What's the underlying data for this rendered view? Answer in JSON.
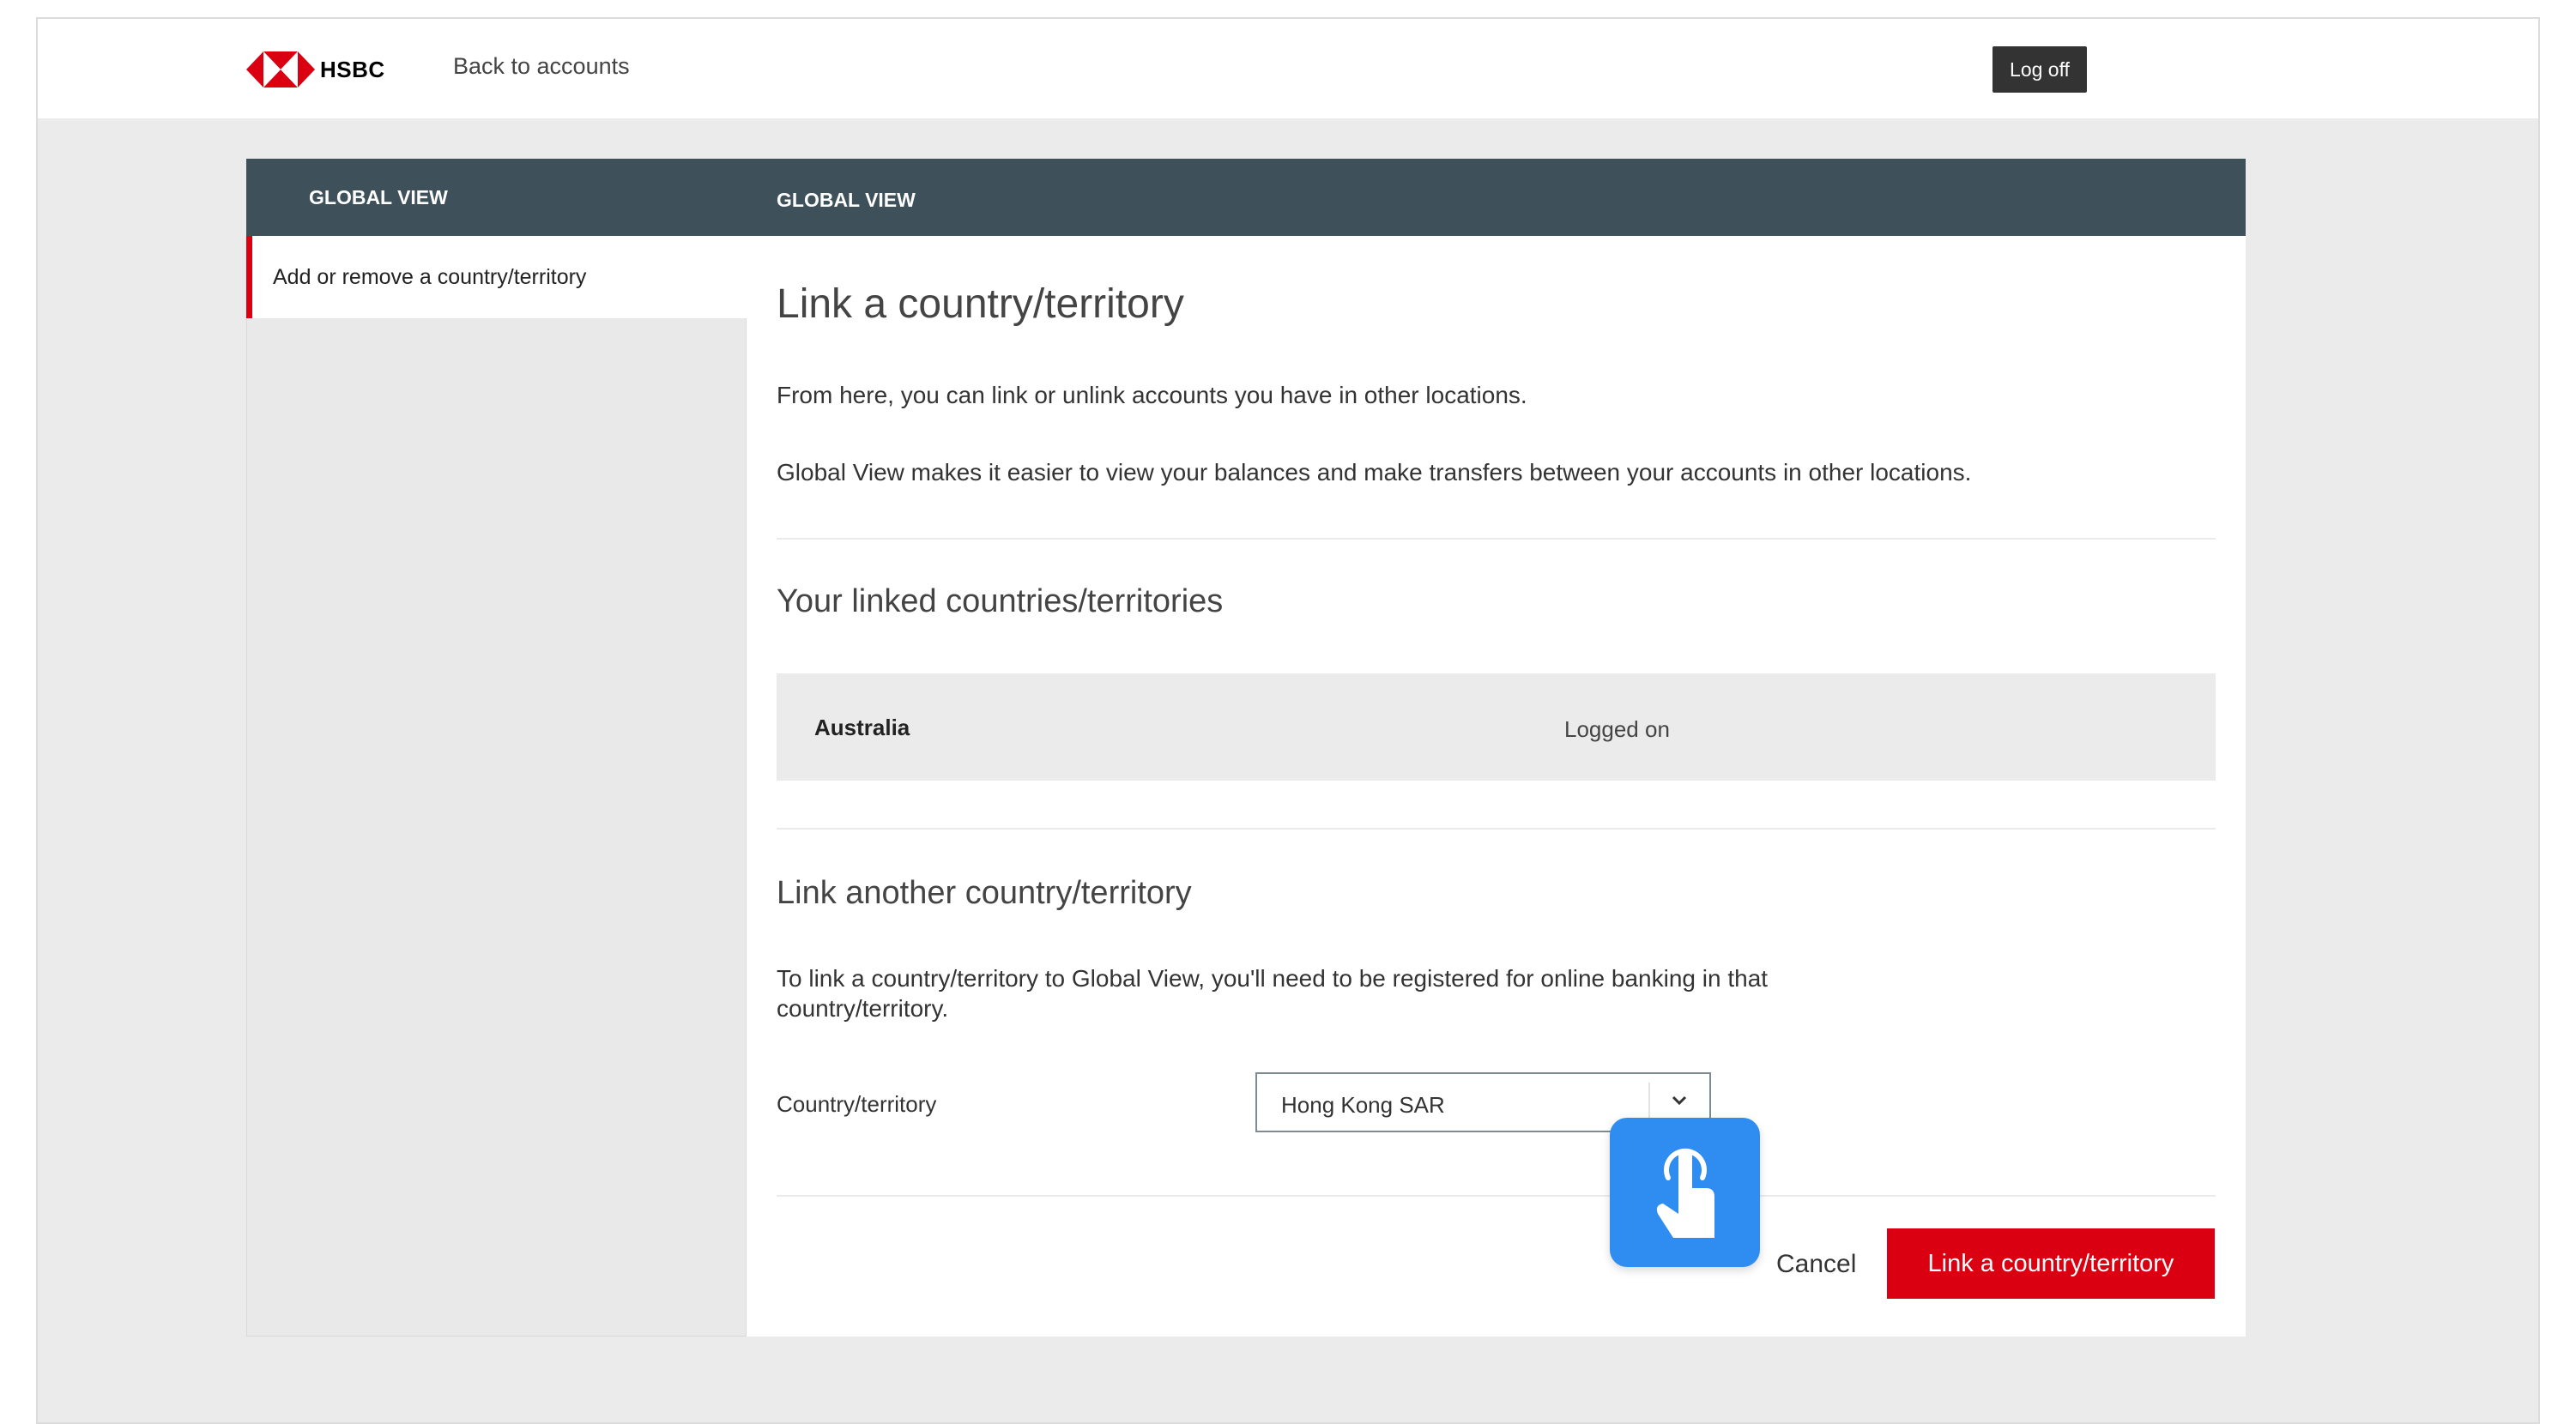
{
  "topbar": {
    "brand": "HSBC",
    "back_link": "Back to accounts",
    "logoff_label": "Log off"
  },
  "header": {
    "left_title": "GLOBAL VIEW",
    "right_title": "GLOBAL VIEW"
  },
  "sidebar": {
    "items": [
      {
        "label": "Add or remove a country/territory",
        "selected": true
      }
    ]
  },
  "main": {
    "title": "Link a country/territory",
    "intro": "From here, you can link or unlink accounts you have in other locations.",
    "description": "Global View makes it easier to view your balances and make transfers between your accounts in other locations.",
    "linked_heading": "Your linked countries/territories",
    "linked": [
      {
        "country": "Australia",
        "status": "Logged on"
      }
    ],
    "link_another_heading": "Link another country/territory",
    "link_note": "To link a country/territory to Global View, you'll need to be registered for online banking in that country/territory.",
    "field_label": "Country/territory",
    "selected_country": "Hong Kong SAR",
    "cancel_label": "Cancel",
    "submit_label": "Link a country/territory"
  },
  "icons": {
    "brand_logo": "hsbc-hexagon-logo",
    "select_arrow": "chevron-down-icon",
    "touch_overlay": "tap-finger-icon"
  },
  "colors": {
    "brand_red": "#db0011",
    "header_band": "#3e505a",
    "touch_overlay": "#2f8df2"
  }
}
